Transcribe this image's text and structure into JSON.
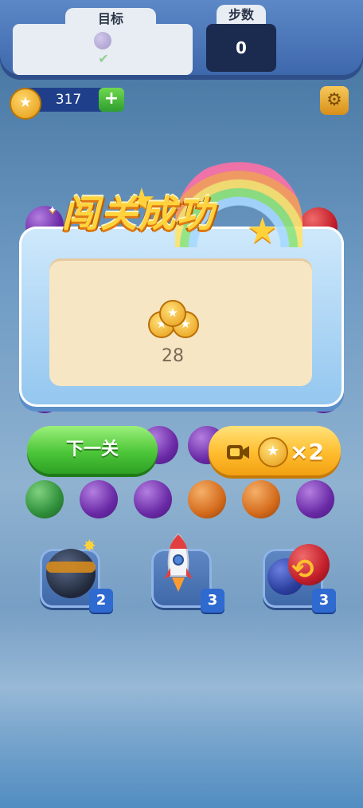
{
  "header": {
    "target_label": "目标",
    "steps_label": "步数",
    "steps_value": "0"
  },
  "coins": {
    "amount": "317",
    "add_label": "+"
  },
  "win_dialog": {
    "title": "闯关成功",
    "reward_amount": "28",
    "next_button_label": "下一关",
    "double_button_label": "×2"
  },
  "boosters": [
    {
      "name": "bomb",
      "count": "2"
    },
    {
      "name": "rocket",
      "count": "3"
    },
    {
      "name": "swap",
      "count": "3"
    }
  ],
  "colors": {
    "accent": "#ffbd2e",
    "success": "#4dc63a",
    "panel": "#93c6ef"
  }
}
